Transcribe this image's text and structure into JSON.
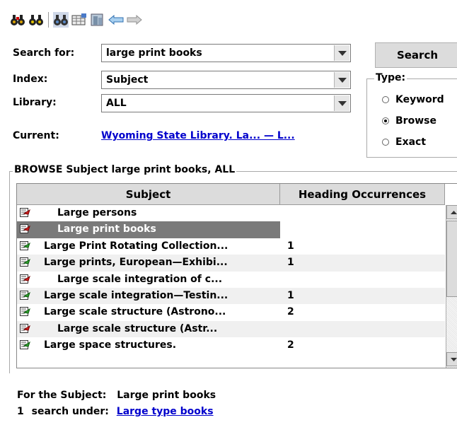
{
  "toolbar": {
    "buttons": [
      {
        "icon": "binoculars-search-icon"
      },
      {
        "icon": "binoculars-back-icon"
      },
      {
        "icon": "binoculars-highlight-icon"
      },
      {
        "icon": "map-grid-icon"
      },
      {
        "icon": "book-stack-icon"
      },
      {
        "icon": "arrow-left-icon"
      },
      {
        "icon": "arrow-right-icon"
      }
    ]
  },
  "form": {
    "search_label": "Search for:",
    "search_value": "large print books",
    "index_label": "Index:",
    "index_value": "Subject",
    "library_label": "Library:",
    "library_value": "ALL",
    "current_label": "Current:",
    "current_value": "Wyoming State Library. La... — L...",
    "search_button": "Search"
  },
  "type": {
    "legend": "Type:",
    "options": [
      {
        "label": "Keyword",
        "selected": false
      },
      {
        "label": "Browse",
        "selected": true
      },
      {
        "label": "Exact",
        "selected": false
      }
    ]
  },
  "browse": {
    "title": "BROWSE Subject large print books, ALL",
    "columns": [
      "Subject",
      "Heading Occurrences"
    ],
    "rows": [
      {
        "subject": "Large persons",
        "count": "",
        "icon": "see-reference-icon",
        "indented": true,
        "selected": false
      },
      {
        "subject": "Large print books",
        "count": "",
        "icon": "see-reference-icon",
        "indented": true,
        "selected": true
      },
      {
        "subject": "Large Print Rotating Collection...",
        "count": "1",
        "icon": "heading-icon",
        "indented": false,
        "selected": false
      },
      {
        "subject": "Large prints, European—Exhibi...",
        "count": "1",
        "icon": "heading-icon",
        "indented": false,
        "selected": false
      },
      {
        "subject": "Large scale integration of c...",
        "count": "",
        "icon": "see-reference-icon",
        "indented": true,
        "selected": false
      },
      {
        "subject": "Large scale integration—Testin...",
        "count": "1",
        "icon": "heading-icon",
        "indented": false,
        "selected": false
      },
      {
        "subject": "Large scale structure (Astrono...",
        "count": "2",
        "icon": "heading-icon",
        "indented": false,
        "selected": false
      },
      {
        "subject": "Large scale structure (Astr...",
        "count": "",
        "icon": "see-reference-icon",
        "indented": true,
        "selected": false
      },
      {
        "subject": "Large space structures.",
        "count": "2",
        "icon": "heading-icon",
        "indented": false,
        "selected": false
      }
    ]
  },
  "info": {
    "for_label": "For the Subject:",
    "for_value": "Large print books",
    "count": "1",
    "search_under_label": "search under:",
    "search_under_value": "Large type books"
  },
  "colors": {
    "link": "#0000cc",
    "selected_row": "#7a7a7a",
    "header_bg": "#dcdcdc"
  }
}
